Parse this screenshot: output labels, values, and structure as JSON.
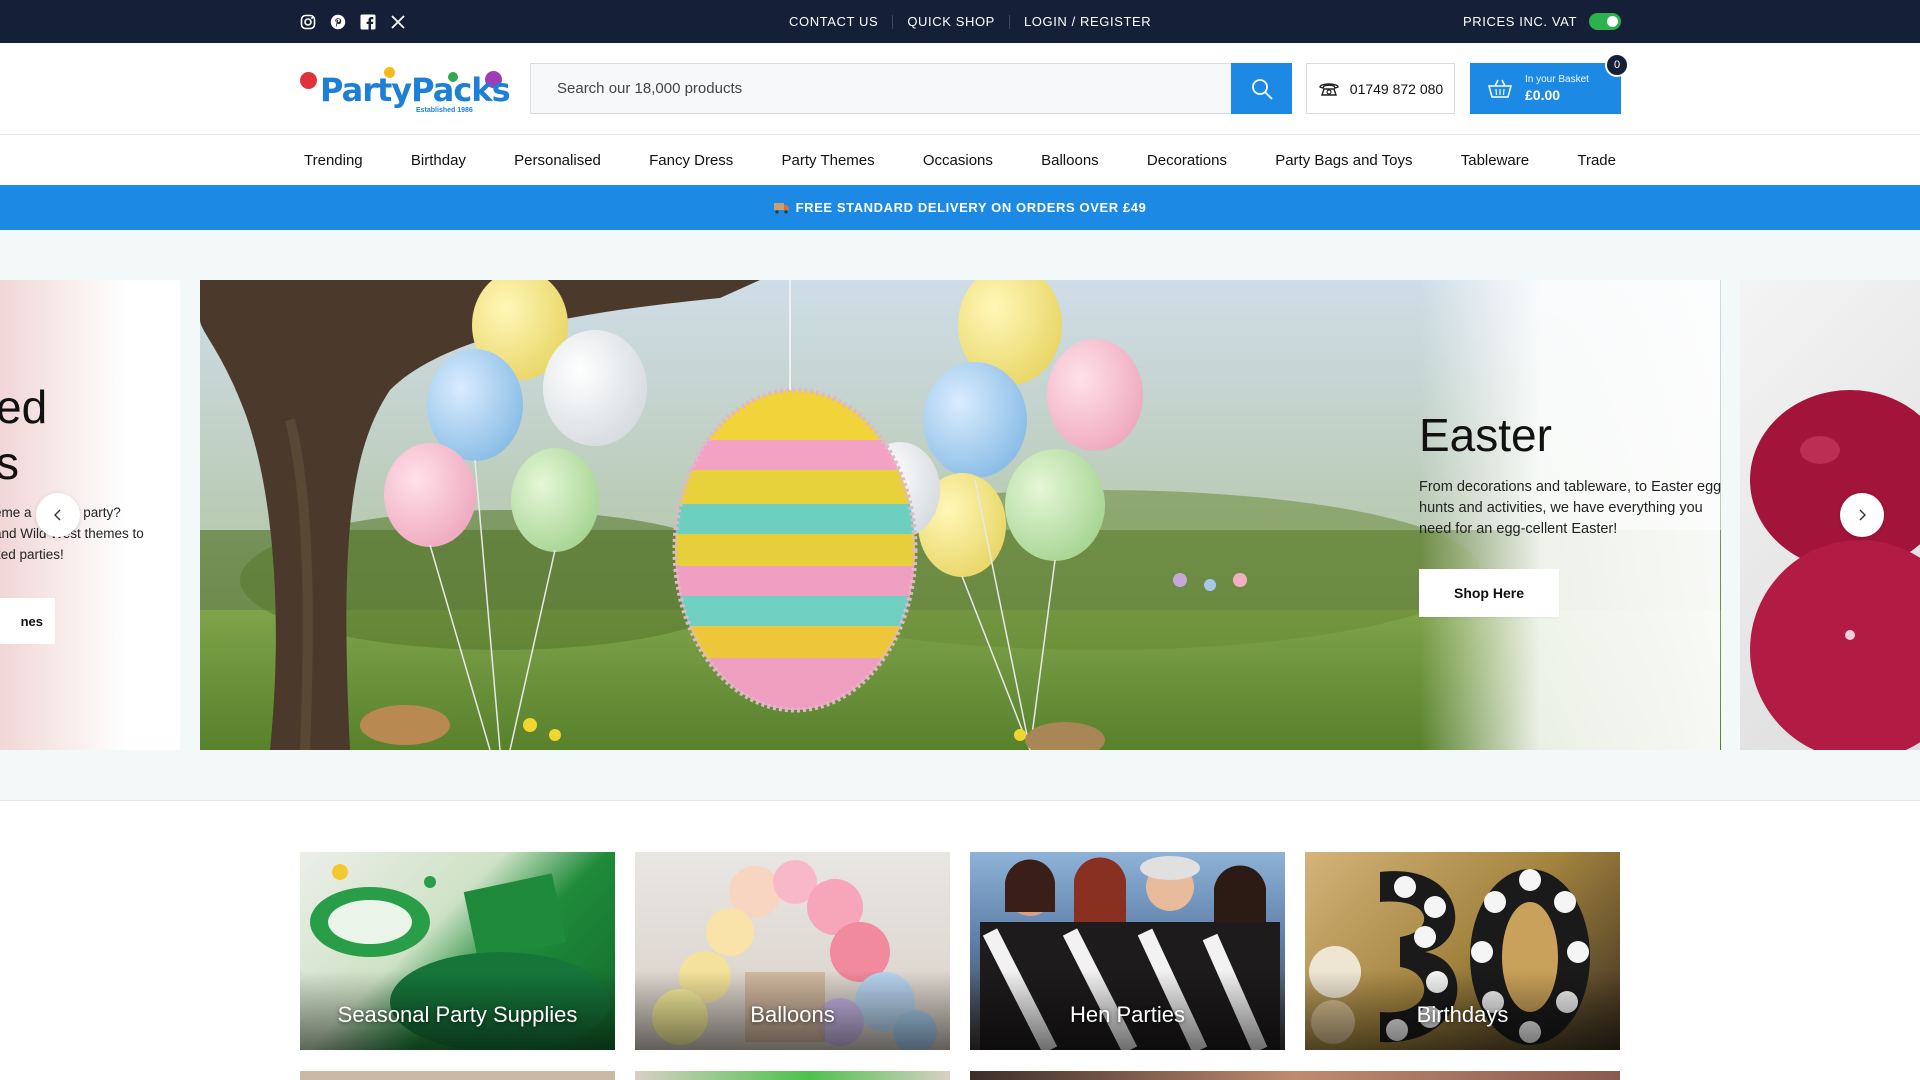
{
  "topbar": {
    "social_icons": [
      "instagram-icon",
      "pinterest-icon",
      "facebook-icon",
      "x-icon"
    ],
    "links": [
      "CONTACT US",
      "QUICK SHOP",
      "LOGIN / REGISTER"
    ],
    "vat_label": "PRICES INC. VAT",
    "vat_toggle_on": true
  },
  "header": {
    "logo_part1": "Party",
    "logo_part2": "Packs",
    "logo_tagline": "Established 1986",
    "search_placeholder": "Search our 18,000 products",
    "phone": "01749 872 080",
    "basket_label": "In your Basket",
    "basket_amount": "£0.00",
    "basket_count": "0"
  },
  "nav": {
    "items": [
      "Trending",
      "Birthday",
      "Personalised",
      "Fancy Dress",
      "Party Themes",
      "Occasions",
      "Balloons",
      "Decorations",
      "Party Bags and Toys",
      "Tableware",
      "Trade"
    ]
  },
  "delivery_banner": "FREE STANDARD DELIVERY ON ORDERS OVER £49",
  "hero": {
    "prev_slide": {
      "line1": "ed",
      "line2": "s",
      "text1": "eme a      next party?",
      "text2": "and Wild West themes to",
      "text3": "ked parties!",
      "button": "nes"
    },
    "title": "Easter",
    "text": "From decorations and tableware, to Easter egg hunts and activities, we have everything you need for an egg-cellent Easter!",
    "button": "Shop Here"
  },
  "categories": [
    "Seasonal Party Supplies",
    "Balloons",
    "Hen Parties",
    "Birthdays"
  ],
  "colors": {
    "topbar": "#152038",
    "brand_blue": "#1c8ae5",
    "toggle_green": "#2bb24c"
  }
}
